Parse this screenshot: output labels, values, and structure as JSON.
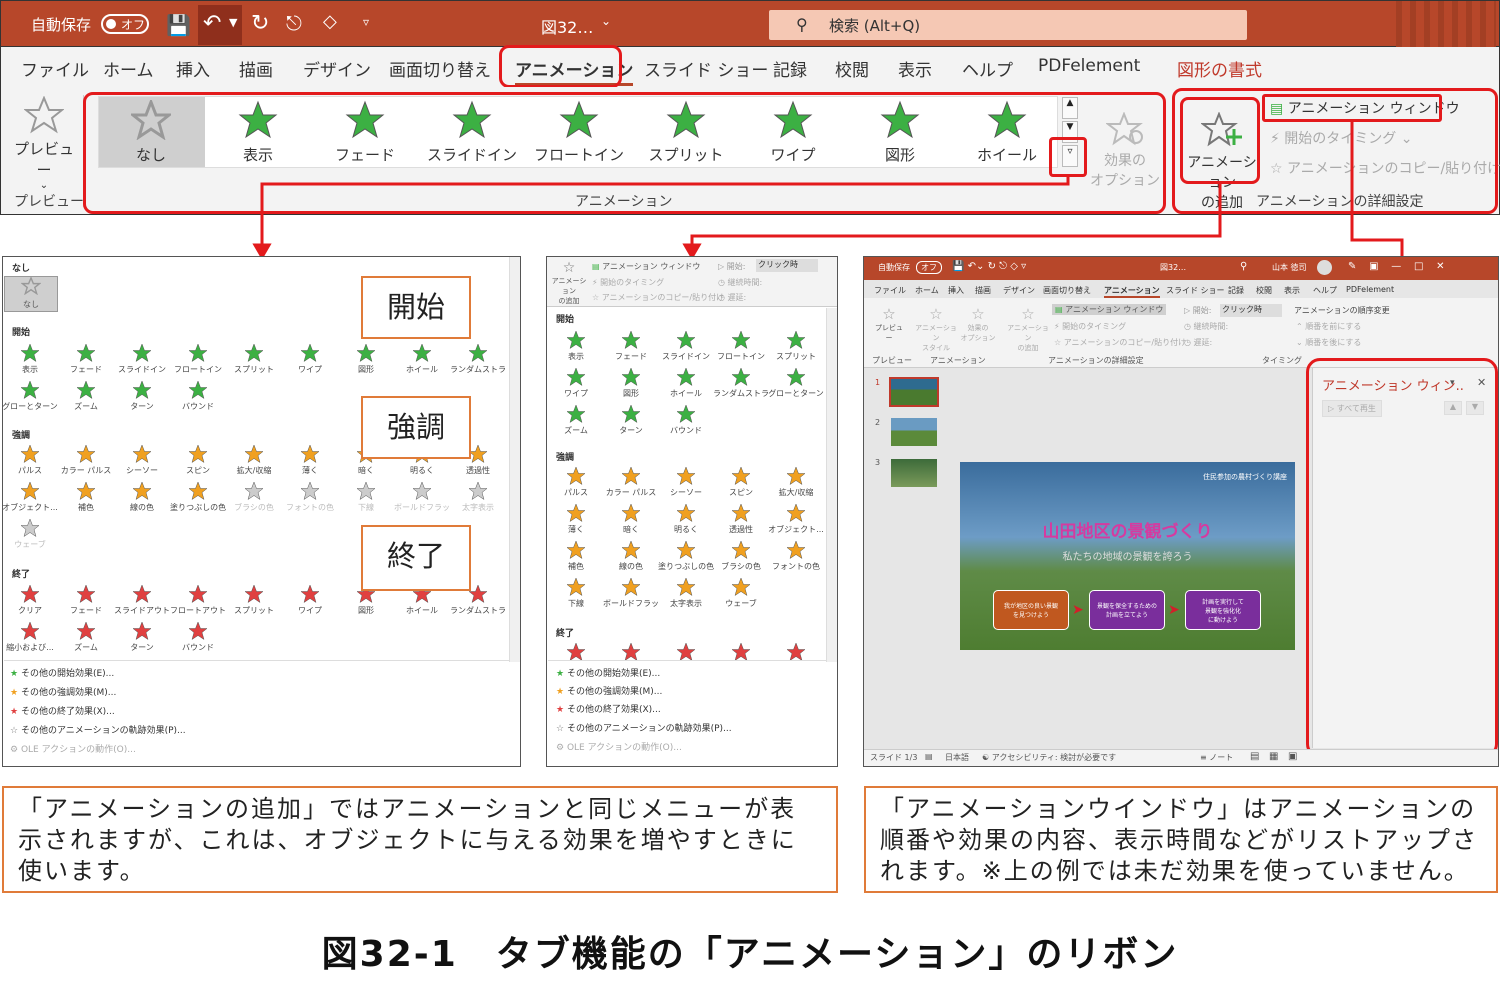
{
  "titlebar": {
    "autosave": "自動保存",
    "toggle": "オフ",
    "filename": "図32…",
    "search": "検索 (Alt+Q)"
  },
  "menu": [
    "ファイル",
    "ホーム",
    "挿入",
    "描画",
    "デザイン",
    "画面切り替え",
    "アニメーション",
    "スライド ショー",
    "記録",
    "校閲",
    "表示",
    "ヘルプ",
    "PDFelement",
    "図形の書式"
  ],
  "ribbon": {
    "preview_btn": "プレビュー",
    "preview_group": "プレビュー",
    "effects": [
      "なし",
      "表示",
      "フェード",
      "スライドイン",
      "フロートイン",
      "スプリット",
      "ワイプ",
      "図形",
      "ホイール"
    ],
    "effect_options": "効果の\nオプション",
    "animation_group": "アニメーション",
    "add_animation": "アニメーション\nの追加",
    "animation_pane": "アニメーション ウィンドウ",
    "trigger": "開始のタイミング",
    "painter": "アニメーションのコピー/貼り付け",
    "advanced_group": "アニメーションの詳細設定"
  },
  "panel1": {
    "none_section": "なし",
    "none": "なし",
    "entrance": "開始",
    "entrance_items": [
      "表示",
      "フェード",
      "スライドイン",
      "フロートイン",
      "スプリット",
      "ワイプ",
      "図形",
      "ホイール",
      "ランダムストラ...",
      "グローとターン",
      "ズーム",
      "ターン",
      "バウンド"
    ],
    "emphasis": "強調",
    "emphasis_items": [
      "パルス",
      "カラー パルス",
      "シーソー",
      "スピン",
      "拡大/収縮",
      "薄く",
      "暗く",
      "明るく",
      "透過性",
      "オブジェクト...",
      "補色",
      "線の色",
      "塗りつぶしの色",
      "ブラシの色",
      "フォントの色",
      "下線",
      "ボールドフラッ...",
      "太字表示",
      "ウェーブ"
    ],
    "exit": "終了",
    "exit_items": [
      "クリア",
      "フェード",
      "スライドアウト",
      "フロートアウト",
      "スプリット",
      "ワイプ",
      "図形",
      "ホイール",
      "ランダムストラ...",
      "縮小および...",
      "ズーム",
      "ターン",
      "バウンド"
    ],
    "more": [
      "その他の開始効果(E)...",
      "その他の強調効果(M)...",
      "その他の終了効果(X)...",
      "その他のアニメーションの軌跡効果(P)...",
      "OLE アクションの動作(O)..."
    ]
  },
  "labels": {
    "start": "開始",
    "emphasis": "強調",
    "exit": "終了"
  },
  "panel2": {
    "add": "アニメーション\nの追加",
    "pane": "アニメーション ウィンドウ",
    "trigger": "開始のタイミング",
    "painter": "アニメーションのコピー/貼り付け",
    "start_label": "開始:",
    "start_value": "クリック時",
    "duration": "継続時間:",
    "delay": "遅延:",
    "entrance": "開始",
    "entrance_items": [
      "表示",
      "フェード",
      "スライドイン",
      "フロートイン",
      "スプリット",
      "ワイプ",
      "図形",
      "ホイール",
      "ランダムストラ...",
      "グローとターン",
      "ズーム",
      "ターン",
      "バウンド"
    ],
    "emphasis": "強調",
    "emphasis_items": [
      "パルス",
      "カラー パルス",
      "シーソー",
      "スピン",
      "拡大/収縮",
      "薄く",
      "暗く",
      "明るく",
      "透過性",
      "オブジェクト...",
      "補色",
      "線の色",
      "塗りつぶしの色",
      "ブラシの色",
      "フォントの色",
      "下線",
      "ボールドフラッ...",
      "太字表示",
      "ウェーブ"
    ],
    "exit": "終了",
    "more": [
      "その他の開始効果(E)...",
      "その他の強調効果(M)...",
      "その他の終了効果(X)...",
      "その他のアニメーションの軌跡効果(P)...",
      "OLE アクションの動作(O)..."
    ]
  },
  "ppt": {
    "autosave": "自動保存",
    "toggle": "オフ",
    "filename": "図32…",
    "user": "山本 徳司",
    "menu": [
      "ファイル",
      "ホーム",
      "挿入",
      "描画",
      "デザイン",
      "画面切り替え",
      "アニメーション",
      "スライド ショー",
      "記録",
      "校閲",
      "表示",
      "ヘルプ",
      "PDFelement"
    ],
    "preview": "プレビュー",
    "anim_style": "アニメーション\nスタイル",
    "effect_opt": "効果の\nオプション",
    "add": "アニメーション\nの追加",
    "pane_btn": "アニメーション ウィンドウ",
    "trigger": "開始のタイミング",
    "painter": "アニメーションのコピー/貼り付け",
    "start": "開始:",
    "start_value": "クリック時",
    "duration": "継続時間:",
    "delay": "遅延:",
    "reorder": "アニメーションの順序変更",
    "earlier": "順番を前にする",
    "later": "順番を後にする",
    "groups": [
      "プレビュー",
      "アニメーション",
      "アニメーションの詳細設定",
      "タイミング"
    ],
    "slide_nums": [
      "1",
      "2",
      "3"
    ],
    "slide_subtitle": "住民参加の農村づくり講座",
    "slide_title": "山田地区の景観づくり",
    "slide_tagline": "私たちの地域の景観を誇ろう",
    "boxes": [
      "我が地区の良い景観\nを見つけよう",
      "景観を保全するための\n計画を立てよう",
      "計画を実行して\n景観を強化化\nに動けよう"
    ],
    "pane_title": "アニメーション ウィン..",
    "play_all": "すべて再生",
    "status": {
      "slide": "スライド 1/3",
      "lang": "日本語",
      "access": "アクセシビリティ: 検討が必要です",
      "notes": "ノート"
    }
  },
  "caption_left": "「アニメーションの追加」ではアニメーションと同じメニューが表示されますが、これは、オブジェクトに与える効果を増やすときに使います。",
  "caption_right": "「アニメーションウインドウ」はアニメーションの順番や効果の内容、表示時間などがリストアップされます。※上の例では未だ効果を使っていません。",
  "figure_title": "図32-1　タブ機能の「アニメーション」のリボン",
  "colors": {
    "accent": "#b7472a",
    "red_box": "#e31a1c",
    "orange": "#e07b39",
    "entrance": "#3cb043",
    "emphasis": "#f0a020",
    "exit": "#e04040"
  }
}
